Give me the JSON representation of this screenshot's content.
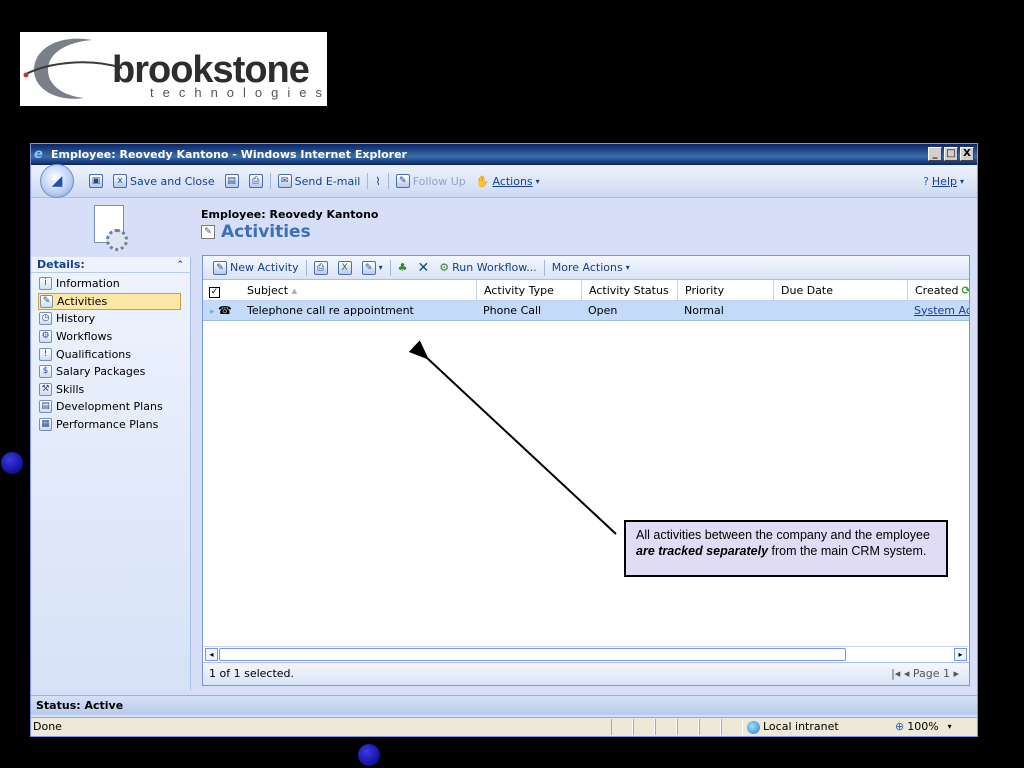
{
  "logo": {
    "word": "brookstone",
    "sub": "technologies"
  },
  "window": {
    "title": "Employee: Reovedy Kantono - Windows Internet Explorer",
    "controls": [
      "_",
      "□",
      "X"
    ]
  },
  "toolbar": {
    "save_and_close": "Save and Close",
    "send_email": "Send E-mail",
    "follow_up": "Follow Up",
    "actions": "Actions",
    "help": "Help"
  },
  "header": {
    "entity_name": "Employee: Reovedy Kantono",
    "page_title": "Activities"
  },
  "left_nav": {
    "heading": "Details:",
    "items": [
      {
        "label": "Information",
        "icon": "info-card-icon",
        "glyph": "i"
      },
      {
        "label": "Activities",
        "icon": "activities-icon",
        "glyph": "✎",
        "selected": true
      },
      {
        "label": "History",
        "icon": "history-icon",
        "glyph": "◷"
      },
      {
        "label": "Workflows",
        "icon": "workflows-icon",
        "glyph": "⚙"
      },
      {
        "label": "Qualifications",
        "icon": "qualifications-icon",
        "glyph": "!"
      },
      {
        "label": "Salary Packages",
        "icon": "dollar-icon",
        "glyph": "$"
      },
      {
        "label": "Skills",
        "icon": "wrench-icon",
        "glyph": "⚒"
      },
      {
        "label": "Development Plans",
        "icon": "development-plans-icon",
        "glyph": "▤"
      },
      {
        "label": "Performance Plans",
        "icon": "performance-plans-icon",
        "glyph": "▦"
      }
    ]
  },
  "grid_toolbar": {
    "new_activity": "New Activity",
    "run_workflow": "Run Workflow...",
    "more_actions": "More Actions"
  },
  "grid": {
    "columns": [
      {
        "label": "Subject",
        "width": 236
      },
      {
        "label": "Activity Type",
        "width": 105
      },
      {
        "label": "Activity Status",
        "width": 96
      },
      {
        "label": "Priority",
        "width": 96
      },
      {
        "label": "Due Date",
        "width": 134
      },
      {
        "label": "Created",
        "width": 62
      }
    ],
    "rows": [
      {
        "subject": "Telephone call re appointment",
        "activity_type": "Phone Call",
        "activity_status": "Open",
        "priority": "Normal",
        "due_date": "",
        "created": "System Adm"
      }
    ],
    "selection_text": "1 of 1 selected.",
    "pager": "Page 1"
  },
  "status": {
    "record_status": "Status: Active",
    "ie_status": "Done",
    "zone": "Local intranet",
    "zoom": "100%"
  },
  "callout": {
    "text_before": "All activities between the company and the employee ",
    "emphasis": "are tracked separately",
    "text_after": " from the main CRM system."
  },
  "colors": {
    "accent": "#3b6fb6",
    "selected_row": "#c3daf9",
    "callout_bg": "#e1dcf5"
  }
}
